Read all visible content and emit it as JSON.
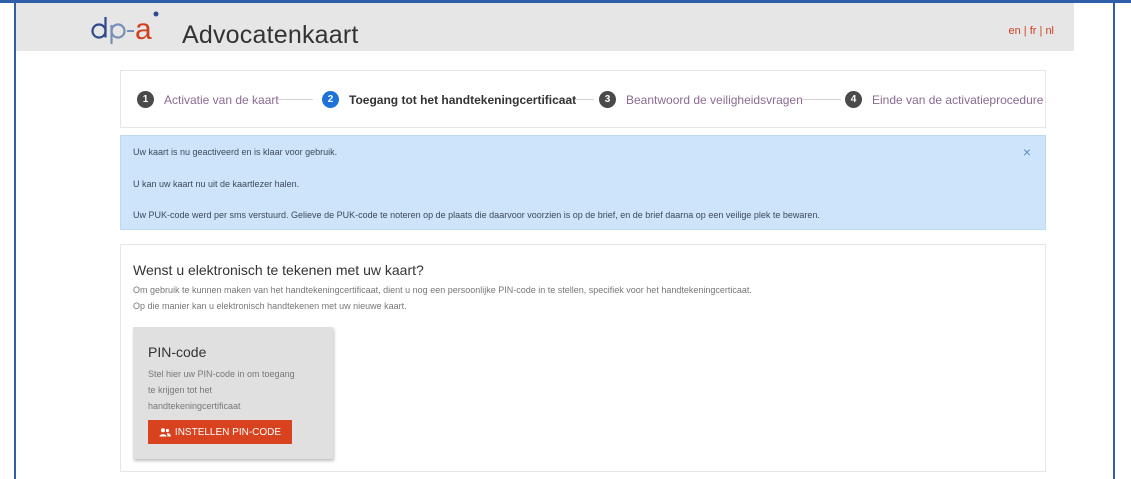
{
  "header": {
    "logo_text": "dp-a",
    "app_title": "Advocatenkaart",
    "languages": [
      "en",
      "fr",
      "nl"
    ],
    "lang_separator": "|"
  },
  "steps": [
    {
      "number": "1",
      "label": "Activatie van de kaart",
      "active": false
    },
    {
      "number": "2",
      "label": "Toegang tot het handtekeningcertificaat",
      "active": true
    },
    {
      "number": "3",
      "label": "Beantwoord de veiligheidsvragen",
      "active": false
    },
    {
      "number": "4",
      "label": "Einde van de activatieprocedure",
      "active": false
    }
  ],
  "alert": {
    "line1": "Uw kaart is nu geactiveerd en is klaar voor gebruik.",
    "line2": "U kan uw kaart nu uit de kaartlezer halen.",
    "line3": "Uw PUK-code werd per sms verstuurd. Gelieve de PUK-code te noteren op de plaats die daarvoor voorzien is op de brief, en de brief daarna op een veilige plek te bewaren.",
    "close_symbol": "×"
  },
  "card": {
    "title": "Wenst u elektronisch te tekenen met uw kaart?",
    "text1": "Om gebruik te kunnen maken van het handtekeningcertificaat, dient u nog een persoonlijke PIN-code in te stellen, specifiek voor het handtekeningcerticaat.",
    "text2": "Op die manier kan u elektronisch handtekenen met uw nieuwe kaart.",
    "pin": {
      "title": "PIN-code",
      "description": "Stel hier uw PIN-code in om toegang te krijgen tot het handtekeningcertificaat",
      "button_label": "INSTELLEN PIN-CODE",
      "button_icon": "users-icon"
    }
  },
  "colors": {
    "accent": "#d9421e",
    "active_step": "#1e73d8",
    "alert_bg": "#cde4fa",
    "header_bg": "#e6e6e6",
    "frame": "#2e5fa8"
  }
}
